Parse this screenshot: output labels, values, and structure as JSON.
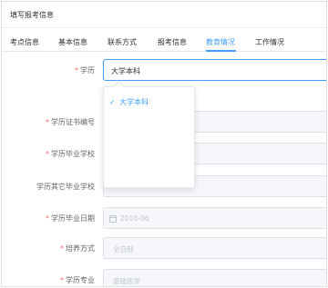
{
  "header": {
    "title": "填写报考信息"
  },
  "tabs": [
    {
      "label": "考点信息",
      "active": false
    },
    {
      "label": "基本信息",
      "active": false
    },
    {
      "label": "联系方式",
      "active": false
    },
    {
      "label": "报考信息",
      "active": false
    },
    {
      "label": "教育情况",
      "active": true
    },
    {
      "label": "工作情况",
      "active": false
    }
  ],
  "form": {
    "required_mark": "*",
    "rows": [
      {
        "label": "学历",
        "required": true,
        "value": "大学本科"
      },
      {
        "label": "学历证书编号",
        "required": true,
        "value": ""
      },
      {
        "label": "学历毕业学校",
        "required": true,
        "value": ""
      },
      {
        "label": "学历其它毕业学校",
        "required": false,
        "value": ""
      },
      {
        "label": "学历毕业日期",
        "required": true,
        "placeholder": "2010-06"
      },
      {
        "label": "培养方式",
        "required": true,
        "placeholder": "全日制"
      },
      {
        "label": "学历专业",
        "required": true,
        "placeholder": "基础医学"
      }
    ]
  },
  "dropdown": {
    "options": [
      {
        "label": "大学本科",
        "selected": true
      }
    ]
  },
  "icons": {
    "check": "check-icon",
    "calendar": "calendar-icon"
  },
  "colors": {
    "accent": "#409eff",
    "required": "#f56c6c",
    "placeholder": "#c0c4cc"
  }
}
